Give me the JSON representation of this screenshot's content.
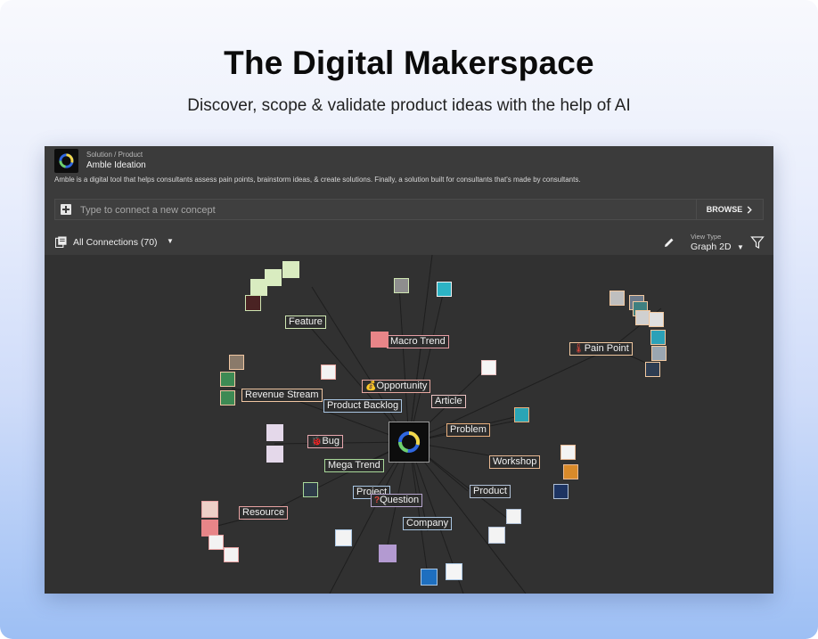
{
  "hero": {
    "title": "The Digital Makerspace",
    "subtitle": "Discover, scope & validate product ideas with the help of AI"
  },
  "app": {
    "breadcrumb": "Solution / Product",
    "name": "Amble Ideation",
    "description": "Amble is a digital tool that helps consultants assess pain points, brainstorm ideas, & create solutions. Finally, a solution built for consultants that's made by consultants.",
    "concept_placeholder": "Type to connect a new concept",
    "browse_label": "BROWSE",
    "connections_label": "All Connections (70)",
    "view_type_label": "View Type",
    "view_type_value": "Graph 2D"
  },
  "icons": {
    "logo": "amble-ring-logo",
    "add": "plus-square-icon",
    "browse": "chevron-right-icon",
    "connections": "library-icon",
    "dropdown": "caret-down-icon",
    "edit": "pencil-icon",
    "filter": "funnel-icon"
  },
  "graph": {
    "labels": {
      "feature": "Feature",
      "macro_trend": "Macro Trend",
      "pain_point": "Pain Point",
      "opportunity": "Opportunity",
      "article": "Article",
      "revenue_stream": "Revenue Stream",
      "product_backlog": "Product Backlog",
      "problem": "Problem",
      "bug": "Bug",
      "workshop": "Workshop",
      "mega_trend": "Mega Trend",
      "project": "Project",
      "question": "Question",
      "product": "Product",
      "resource": "Resource",
      "company": "Company"
    },
    "colors": {
      "feature": "#cfe6b2",
      "macro_trend": "#e69ea4",
      "pain_point": "#f1c8a0",
      "opportunity": "#e8a7a0",
      "article": "#e9c0c0",
      "revenue_stream": "#f0c6a2",
      "product_backlog": "#a9c6e3",
      "problem": "#e9b07e",
      "bug": "#e7a7ae",
      "workshop": "#e8b994",
      "mega_trend": "#a9d99a",
      "project": "#a9c6e3",
      "question": "#b7a6cf",
      "product": "#b0c0d6",
      "resource": "#e8a3a3",
      "company": "#a9c6e3"
    }
  }
}
